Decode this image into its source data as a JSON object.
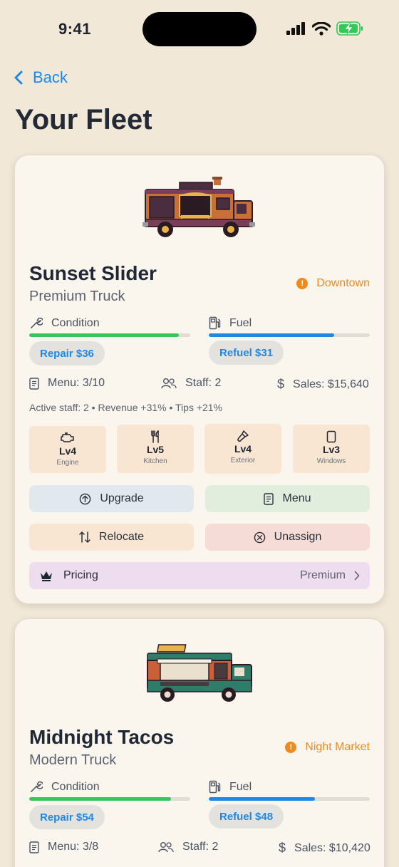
{
  "status": {
    "time": "9:41"
  },
  "nav": {
    "back_label": "Back"
  },
  "page": {
    "title": "Your Fleet"
  },
  "trucks": [
    {
      "name": "Sunset Slider",
      "type": "Premium Truck",
      "location": "Downtown",
      "condition_label": "Condition",
      "condition_pct": 93,
      "fuel_label": "Fuel",
      "fuel_pct": 78,
      "repair_label": "Repair $36",
      "refuel_label": "Refuel $31",
      "menu": "Menu: 3/10",
      "staff": "Staff: 2",
      "sales": "Sales: $15,640",
      "summary": "Active staff: 2 • Revenue +31% • Tips +21%",
      "upgrades": [
        {
          "level": "Lv4",
          "name": "Engine",
          "icon": "engine-icon"
        },
        {
          "level": "Lv5",
          "name": "Kitchen",
          "icon": "fork-knife-icon"
        },
        {
          "level": "Lv4",
          "name": "Exterior",
          "icon": "paintbrush-icon"
        },
        {
          "level": "Lv3",
          "name": "Windows",
          "icon": "window-icon"
        }
      ],
      "actions": {
        "upgrade": "Upgrade",
        "menu": "Menu",
        "relocate": "Relocate",
        "unassign": "Unassign"
      },
      "pricing_label": "Pricing",
      "pricing_value": "Premium"
    },
    {
      "name": "Midnight Tacos",
      "type": "Modern Truck",
      "location": "Night Market",
      "condition_label": "Condition",
      "condition_pct": 88,
      "fuel_label": "Fuel",
      "fuel_pct": 66,
      "repair_label": "Repair $54",
      "refuel_label": "Refuel $48",
      "menu": "Menu: 3/8",
      "staff": "Staff: 2",
      "sales": "Sales: $10,420"
    }
  ],
  "colors": {
    "accent": "#1e88e5",
    "location": "#f08a1c",
    "condition": "#34c759",
    "fuel": "#1e88e5",
    "upgrade_bg": "#e2e9ee",
    "menu_bg": "#e2eedd",
    "relocate_bg": "#f8e6d2",
    "unassign_bg": "#f6dcd6",
    "pricing_bg": "#eedcef"
  }
}
